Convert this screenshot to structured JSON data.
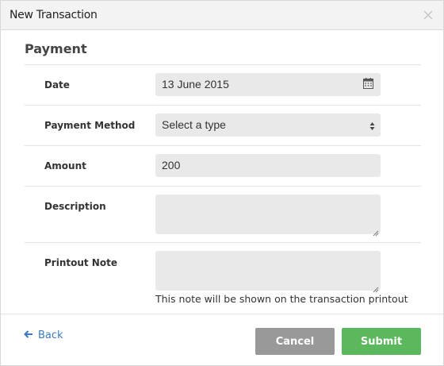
{
  "header": {
    "title": "New Transaction"
  },
  "section": {
    "title": "Payment"
  },
  "fields": {
    "date": {
      "label": "Date",
      "value": "13 June 2015"
    },
    "payment_method": {
      "label": "Payment Method",
      "value": "Select a type"
    },
    "amount": {
      "label": "Amount",
      "value": "200"
    },
    "description": {
      "label": "Description",
      "value": ""
    },
    "printout_note": {
      "label": "Printout Note",
      "value": "",
      "help": "This note will be shown on the transaction printout"
    }
  },
  "footer": {
    "back_label": "Back",
    "cancel_label": "Cancel",
    "submit_label": "Submit"
  },
  "icons": {
    "close": "close-icon",
    "calendar": "calendar-icon",
    "select": "select-arrows-icon",
    "back": "arrow-left-icon"
  },
  "colors": {
    "link": "#3a7bbf",
    "submit": "#5cb85c",
    "cancel": "#999999",
    "input_bg": "#e9e9e9",
    "header_bg": "#f3f3f3"
  }
}
